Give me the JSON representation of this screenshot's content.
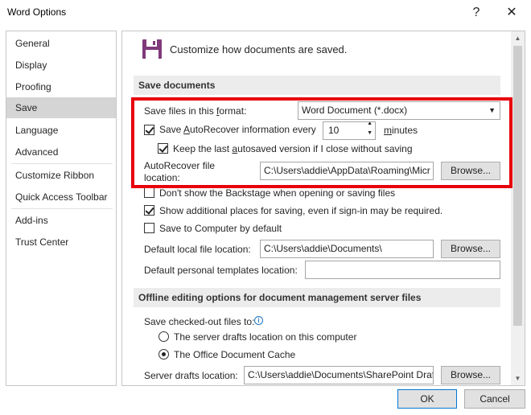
{
  "window": {
    "title": "Word Options",
    "help_glyph": "?",
    "close_glyph": "✕"
  },
  "sidebar": {
    "items": [
      {
        "label": "General"
      },
      {
        "label": "Display"
      },
      {
        "label": "Proofing"
      },
      {
        "label": "Save",
        "selected": true
      },
      {
        "label": "Language"
      },
      {
        "label": "Advanced"
      },
      {
        "label": "Customize Ribbon"
      },
      {
        "label": "Quick Access Toolbar"
      },
      {
        "label": "Add-ins"
      },
      {
        "label": "Trust Center"
      }
    ]
  },
  "header": {
    "icon": "floppy-disk-icon",
    "text": "Customize how documents are saved."
  },
  "save_documents": {
    "heading": "Save documents",
    "format_label": "Save files in this format:",
    "format_value": "Word Document (*.docx)",
    "autorecover_label": "Save AutoRecover information every",
    "autorecover_checked": true,
    "autorecover_minutes": "10",
    "minutes_label": "minutes",
    "keep_last_label": "Keep the last autosaved version if I close without saving",
    "keep_last_checked": true,
    "autorecover_location_label_1": "AutoRecover file",
    "autorecover_location_label_2": "location:",
    "autorecover_location_value": "C:\\Users\\addie\\AppData\\Roaming\\Micr",
    "browse_label": "Browse...",
    "dont_show_backstage_label": "Don't show the Backstage when opening or saving files",
    "dont_show_backstage_checked": false,
    "show_additional_label": "Show additional places for saving, even if sign-in may be required.",
    "show_additional_checked": true,
    "save_to_computer_label": "Save to Computer by default",
    "save_to_computer_checked": false,
    "default_local_label": "Default local file location:",
    "default_local_value": "C:\\Users\\addie\\Documents\\",
    "default_local_browse": "Browse...",
    "default_templates_label": "Default personal templates location:",
    "default_templates_value": ""
  },
  "offline": {
    "heading": "Offline editing options for document management server files",
    "save_checked_out_label": "Save checked-out files to:",
    "info_icon": "info-icon",
    "radio_server_drafts": "The server drafts location on this computer",
    "radio_server_drafts_selected": false,
    "radio_office_cache": "The Office Document Cache",
    "radio_office_cache_selected": true,
    "server_drafts_label": "Server drafts location:",
    "server_drafts_value": "C:\\Users\\addie\\Documents\\SharePoint Draf",
    "server_drafts_browse": "Browse..."
  },
  "footer": {
    "ok_label": "OK",
    "cancel_label": "Cancel"
  },
  "colors": {
    "highlight_box": "#e8000b",
    "selected_nav": "#d5d5d5",
    "section_bg": "#ececec",
    "icon_purple": "#80397b"
  }
}
